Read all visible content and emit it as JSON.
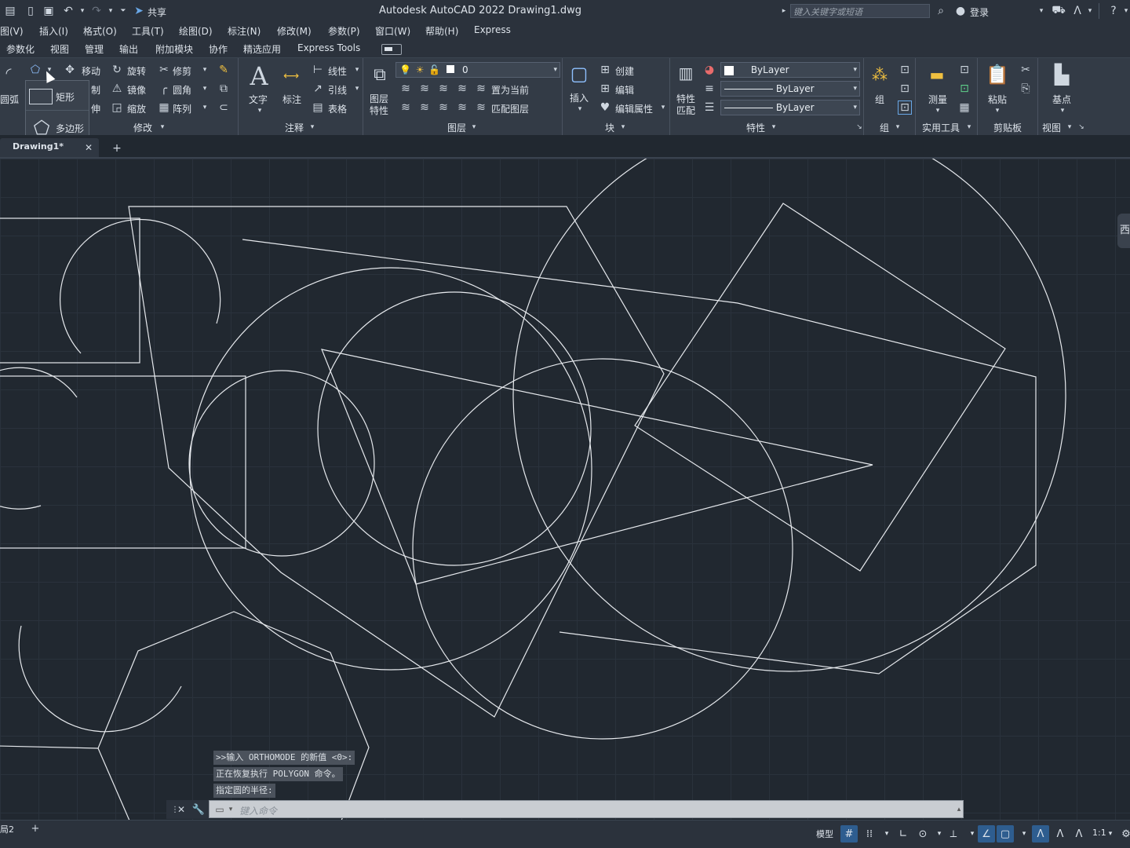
{
  "titlebar": {
    "title": "Autodesk AutoCAD 2022    Drawing1.dwg",
    "share_label": "共享",
    "search_placeholder": "键入关键字或短语",
    "signin_label": "登录"
  },
  "menubar": {
    "items": [
      "图(V)",
      "插入(I)",
      "格式(O)",
      "工具(T)",
      "绘图(D)",
      "标注(N)",
      "修改(M)",
      "参数(P)",
      "窗口(W)",
      "帮助(H)",
      "Express"
    ]
  },
  "ribbon_tabs": {
    "items": [
      "参数化",
      "视图",
      "管理",
      "输出",
      "附加模块",
      "协作",
      "精选应用",
      "Express Tools"
    ]
  },
  "ribbon": {
    "draw": {
      "arc_label": "圆弧"
    },
    "modify": {
      "move": "移动",
      "rotate": "旋转",
      "trim": "修剪",
      "copy": "制",
      "mirror": "镜像",
      "fillet": "圆角",
      "stretch": "伸",
      "scale": "缩放",
      "array": "阵列",
      "panel_label": "修改"
    },
    "annotation": {
      "text": "文字",
      "dimension": "标注",
      "linear": "线性",
      "leader": "引线",
      "table": "表格",
      "panel_label": "注释"
    },
    "layers": {
      "properties_line1": "图层",
      "properties_line2": "特性",
      "current_layer": "0",
      "make_current": "置为当前",
      "match_layer": "匹配图层",
      "panel_label": "图层"
    },
    "block": {
      "insert": "插入",
      "create": "创建",
      "edit": "编辑",
      "edit_attributes": "编辑属性",
      "panel_label": "块"
    },
    "properties": {
      "match_line1": "特性",
      "match_line2": "匹配",
      "color": "ByLayer",
      "linetype": "ByLayer",
      "lineweight": "ByLayer",
      "panel_label": "特性"
    },
    "groups": {
      "group": "组",
      "panel_label": "组"
    },
    "utilities": {
      "measure": "测量",
      "panel_label": "实用工具"
    },
    "clipboard": {
      "paste": "粘贴",
      "panel_label": "剪贴板"
    },
    "view": {
      "base": "基点",
      "panel_label": "视图"
    }
  },
  "dropdown": {
    "items": [
      "矩形",
      "多边形"
    ]
  },
  "doctabs": {
    "active_tab": "Drawing1*"
  },
  "command": {
    "history": [
      ">>输入 ORTHOMODE 的新值 <0>:",
      "正在恢复执行 POLYGON 命令。",
      "指定圆的半径:"
    ],
    "input_placeholder": "键入命令"
  },
  "status": {
    "layout_tab": "局2",
    "model_label": "模型",
    "scale_label": "1:1"
  },
  "viewcube_label": "西",
  "colors": {
    "accent": "#2e5d8f",
    "canvas": "#212830",
    "lines": "#e6e9ed"
  }
}
